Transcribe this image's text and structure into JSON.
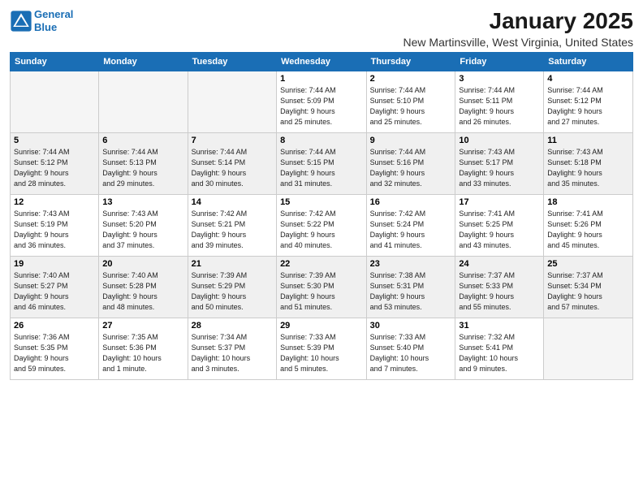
{
  "header": {
    "logo_line1": "General",
    "logo_line2": "Blue",
    "title": "January 2025",
    "subtitle": "New Martinsville, West Virginia, United States"
  },
  "days_of_week": [
    "Sunday",
    "Monday",
    "Tuesday",
    "Wednesday",
    "Thursday",
    "Friday",
    "Saturday"
  ],
  "weeks": [
    [
      {
        "num": "",
        "info": ""
      },
      {
        "num": "",
        "info": ""
      },
      {
        "num": "",
        "info": ""
      },
      {
        "num": "1",
        "info": "Sunrise: 7:44 AM\nSunset: 5:09 PM\nDaylight: 9 hours\nand 25 minutes."
      },
      {
        "num": "2",
        "info": "Sunrise: 7:44 AM\nSunset: 5:10 PM\nDaylight: 9 hours\nand 25 minutes."
      },
      {
        "num": "3",
        "info": "Sunrise: 7:44 AM\nSunset: 5:11 PM\nDaylight: 9 hours\nand 26 minutes."
      },
      {
        "num": "4",
        "info": "Sunrise: 7:44 AM\nSunset: 5:12 PM\nDaylight: 9 hours\nand 27 minutes."
      }
    ],
    [
      {
        "num": "5",
        "info": "Sunrise: 7:44 AM\nSunset: 5:12 PM\nDaylight: 9 hours\nand 28 minutes."
      },
      {
        "num": "6",
        "info": "Sunrise: 7:44 AM\nSunset: 5:13 PM\nDaylight: 9 hours\nand 29 minutes."
      },
      {
        "num": "7",
        "info": "Sunrise: 7:44 AM\nSunset: 5:14 PM\nDaylight: 9 hours\nand 30 minutes."
      },
      {
        "num": "8",
        "info": "Sunrise: 7:44 AM\nSunset: 5:15 PM\nDaylight: 9 hours\nand 31 minutes."
      },
      {
        "num": "9",
        "info": "Sunrise: 7:44 AM\nSunset: 5:16 PM\nDaylight: 9 hours\nand 32 minutes."
      },
      {
        "num": "10",
        "info": "Sunrise: 7:43 AM\nSunset: 5:17 PM\nDaylight: 9 hours\nand 33 minutes."
      },
      {
        "num": "11",
        "info": "Sunrise: 7:43 AM\nSunset: 5:18 PM\nDaylight: 9 hours\nand 35 minutes."
      }
    ],
    [
      {
        "num": "12",
        "info": "Sunrise: 7:43 AM\nSunset: 5:19 PM\nDaylight: 9 hours\nand 36 minutes."
      },
      {
        "num": "13",
        "info": "Sunrise: 7:43 AM\nSunset: 5:20 PM\nDaylight: 9 hours\nand 37 minutes."
      },
      {
        "num": "14",
        "info": "Sunrise: 7:42 AM\nSunset: 5:21 PM\nDaylight: 9 hours\nand 39 minutes."
      },
      {
        "num": "15",
        "info": "Sunrise: 7:42 AM\nSunset: 5:22 PM\nDaylight: 9 hours\nand 40 minutes."
      },
      {
        "num": "16",
        "info": "Sunrise: 7:42 AM\nSunset: 5:24 PM\nDaylight: 9 hours\nand 41 minutes."
      },
      {
        "num": "17",
        "info": "Sunrise: 7:41 AM\nSunset: 5:25 PM\nDaylight: 9 hours\nand 43 minutes."
      },
      {
        "num": "18",
        "info": "Sunrise: 7:41 AM\nSunset: 5:26 PM\nDaylight: 9 hours\nand 45 minutes."
      }
    ],
    [
      {
        "num": "19",
        "info": "Sunrise: 7:40 AM\nSunset: 5:27 PM\nDaylight: 9 hours\nand 46 minutes."
      },
      {
        "num": "20",
        "info": "Sunrise: 7:40 AM\nSunset: 5:28 PM\nDaylight: 9 hours\nand 48 minutes."
      },
      {
        "num": "21",
        "info": "Sunrise: 7:39 AM\nSunset: 5:29 PM\nDaylight: 9 hours\nand 50 minutes."
      },
      {
        "num": "22",
        "info": "Sunrise: 7:39 AM\nSunset: 5:30 PM\nDaylight: 9 hours\nand 51 minutes."
      },
      {
        "num": "23",
        "info": "Sunrise: 7:38 AM\nSunset: 5:31 PM\nDaylight: 9 hours\nand 53 minutes."
      },
      {
        "num": "24",
        "info": "Sunrise: 7:37 AM\nSunset: 5:33 PM\nDaylight: 9 hours\nand 55 minutes."
      },
      {
        "num": "25",
        "info": "Sunrise: 7:37 AM\nSunset: 5:34 PM\nDaylight: 9 hours\nand 57 minutes."
      }
    ],
    [
      {
        "num": "26",
        "info": "Sunrise: 7:36 AM\nSunset: 5:35 PM\nDaylight: 9 hours\nand 59 minutes."
      },
      {
        "num": "27",
        "info": "Sunrise: 7:35 AM\nSunset: 5:36 PM\nDaylight: 10 hours\nand 1 minute."
      },
      {
        "num": "28",
        "info": "Sunrise: 7:34 AM\nSunset: 5:37 PM\nDaylight: 10 hours\nand 3 minutes."
      },
      {
        "num": "29",
        "info": "Sunrise: 7:33 AM\nSunset: 5:39 PM\nDaylight: 10 hours\nand 5 minutes."
      },
      {
        "num": "30",
        "info": "Sunrise: 7:33 AM\nSunset: 5:40 PM\nDaylight: 10 hours\nand 7 minutes."
      },
      {
        "num": "31",
        "info": "Sunrise: 7:32 AM\nSunset: 5:41 PM\nDaylight: 10 hours\nand 9 minutes."
      },
      {
        "num": "",
        "info": ""
      }
    ]
  ],
  "alt_weeks": [
    false,
    true,
    false,
    true,
    false
  ]
}
